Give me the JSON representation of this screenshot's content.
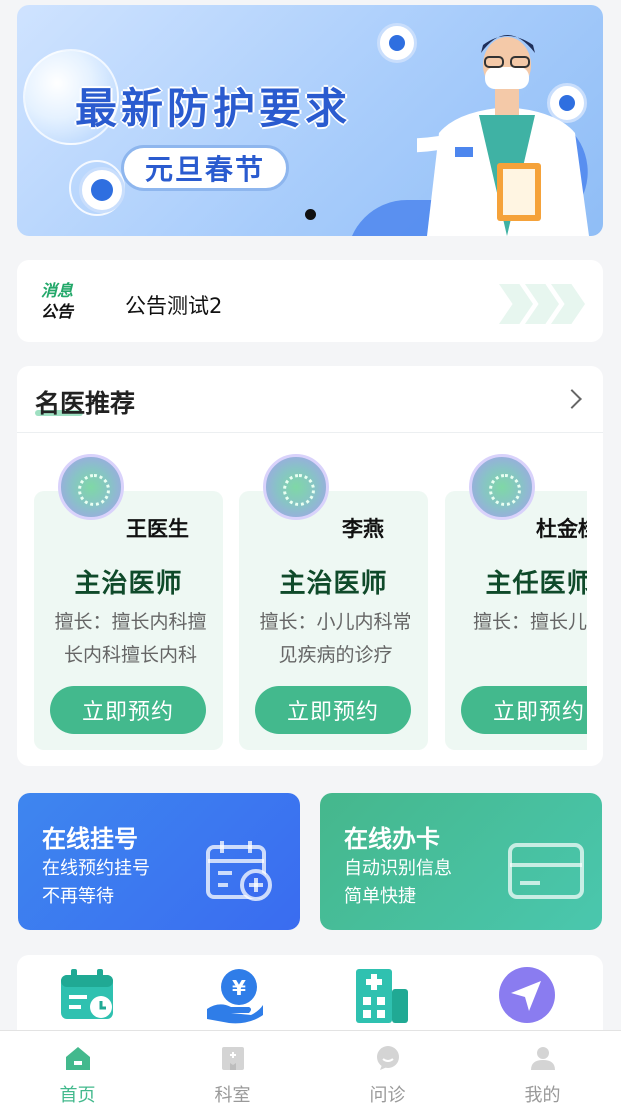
{
  "banner": {
    "title": "最新防护要求",
    "subtitle": "元旦春节"
  },
  "notice": {
    "tag_line1": "消息",
    "tag_line2": "公告",
    "text": "公告测试2"
  },
  "doctors_section": {
    "title": "名医推荐",
    "doctors": [
      {
        "name": "王医生",
        "rank": "主治医师",
        "desc": "擅长：擅长内科擅长内科擅长内科",
        "button": "立即预约"
      },
      {
        "name": "李燕",
        "rank": "主治医师",
        "desc": "擅长：小儿内科常见疾病的诊疗",
        "button": "立即预约"
      },
      {
        "name": "杜金桂",
        "rank": "主任医师",
        "desc": "擅长：擅长儿",
        "button": "立即预约"
      }
    ]
  },
  "features": {
    "registration": {
      "title": "在线挂号",
      "line1": "在线预约挂号",
      "line2": "不再等待"
    },
    "card": {
      "title": "在线办卡",
      "line1": "自动识别信息",
      "line2": "简单快捷"
    }
  },
  "tabbar": {
    "items": [
      {
        "label": "首页",
        "icon": "home-icon",
        "active": true
      },
      {
        "label": "科室",
        "icon": "department-icon",
        "active": false
      },
      {
        "label": "问诊",
        "icon": "chat-icon",
        "active": false
      },
      {
        "label": "我的",
        "icon": "user-icon",
        "active": false
      }
    ]
  },
  "colors": {
    "accent_green": "#43b98d",
    "accent_blue": "#3e86ef",
    "rank_text": "#0f4a2a"
  }
}
